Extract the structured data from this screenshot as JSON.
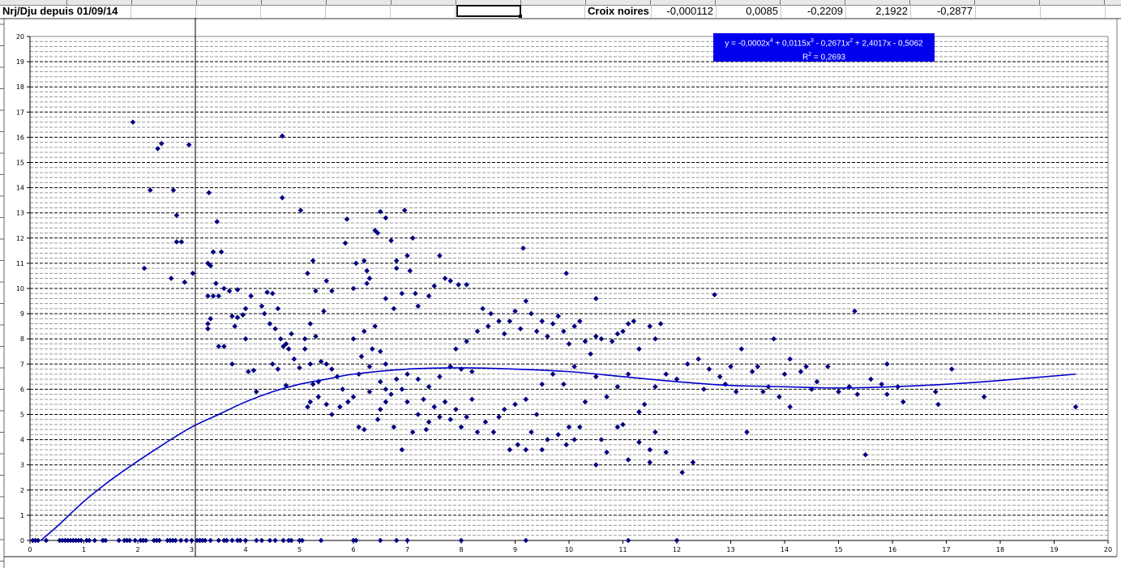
{
  "spreadsheet": {
    "title_cell": "Nrj/Dju depuis 01/09/14",
    "label_cell": "Croix noires",
    "coefficients": [
      "-0,000112",
      "0,0085",
      "-0,2209",
      "2,1922",
      "-0,2877"
    ]
  },
  "chart_data": {
    "type": "scatter",
    "title": "",
    "xlabel": "",
    "ylabel": "",
    "xlim": [
      0,
      20
    ],
    "ylim": [
      0,
      20
    ],
    "grid": "major dashed every 1, minor dashed every 0.2 (horizontal)",
    "x_ticks": [
      "0",
      "1",
      "2",
      "3",
      "4",
      "5",
      "6",
      "7",
      "8",
      "9",
      "10",
      "11",
      "12",
      "13",
      "14",
      "15",
      "16",
      "17",
      "18",
      "19",
      "20"
    ],
    "y_ticks": [
      "0",
      "1",
      "2",
      "3",
      "4",
      "5",
      "6",
      "7",
      "8",
      "9",
      "10",
      "11",
      "12",
      "13",
      "14",
      "15",
      "16",
      "17",
      "18",
      "19",
      "20"
    ],
    "marker_color": "#000080",
    "trend_color": "#0000cc",
    "trendline": {
      "type": "polynomial order 4",
      "equation_parts": [
        "y = -0,0002x",
        "4",
        " + 0,0115x",
        "3",
        " - 0,2671x",
        "2",
        " + 2,4017x - 0,5062"
      ],
      "r2_prefix": "R",
      "r2_sup": "2",
      "r2_value": " = 0,2693",
      "points": [
        [
          0.2,
          0
        ],
        [
          0.5,
          0.55
        ],
        [
          1,
          1.55
        ],
        [
          1.5,
          2.4
        ],
        [
          2,
          3.15
        ],
        [
          2.5,
          3.85
        ],
        [
          3,
          4.5
        ],
        [
          3.5,
          5.0
        ],
        [
          4,
          5.5
        ],
        [
          4.5,
          5.9
        ],
        [
          5,
          6.2
        ],
        [
          5.5,
          6.4
        ],
        [
          6,
          6.6
        ],
        [
          7,
          6.8
        ],
        [
          8,
          6.85
        ],
        [
          9,
          6.8
        ],
        [
          10,
          6.7
        ],
        [
          11,
          6.5
        ],
        [
          12,
          6.3
        ],
        [
          13,
          6.15
        ],
        [
          14,
          6.1
        ],
        [
          15,
          6.05
        ],
        [
          16,
          6.1
        ],
        [
          17,
          6.2
        ],
        [
          18,
          6.35
        ],
        [
          19.4,
          6.6
        ]
      ]
    },
    "points": [
      [
        1.91,
        16.6
      ],
      [
        2.23,
        13.9
      ],
      [
        2.37,
        15.55
      ],
      [
        2.44,
        15.75
      ],
      [
        2.66,
        13.9
      ],
      [
        2.72,
        12.9
      ],
      [
        2.72,
        11.85
      ],
      [
        2.81,
        11.85
      ],
      [
        2.95,
        15.7
      ],
      [
        2.12,
        10.8
      ],
      [
        2.62,
        10.4
      ],
      [
        2.87,
        10.25
      ],
      [
        3.02,
        10.6
      ],
      [
        3.32,
        13.8
      ],
      [
        3.47,
        12.65
      ],
      [
        4.68,
        16.05
      ],
      [
        4.68,
        13.6
      ],
      [
        5.02,
        13.1
      ],
      [
        5.88,
        12.75
      ],
      [
        3.3,
        11.0
      ],
      [
        3.35,
        10.9
      ],
      [
        3.4,
        11.45
      ],
      [
        3.55,
        11.45
      ],
      [
        3.3,
        9.7
      ],
      [
        3.4,
        9.7
      ],
      [
        3.5,
        9.7
      ],
      [
        3.45,
        10.2
      ],
      [
        3.6,
        10.0
      ],
      [
        3.7,
        9.9
      ],
      [
        3.85,
        9.95
      ],
      [
        3.3,
        8.6
      ],
      [
        3.35,
        8.8
      ],
      [
        3.3,
        8.4
      ],
      [
        3.75,
        8.9
      ],
      [
        3.85,
        8.85
      ],
      [
        3.95,
        8.95
      ],
      [
        3.8,
        8.5
      ],
      [
        4.0,
        9.2
      ],
      [
        4.1,
        9.7
      ],
      [
        3.5,
        7.7
      ],
      [
        3.6,
        7.7
      ],
      [
        4.0,
        8.0
      ],
      [
        3.75,
        7.0
      ],
      [
        4.05,
        6.7
      ],
      [
        4.15,
        6.75
      ],
      [
        4.2,
        5.9
      ],
      [
        4.3,
        9.3
      ],
      [
        4.4,
        9.85
      ],
      [
        4.5,
        9.8
      ],
      [
        4.35,
        9.0
      ],
      [
        4.45,
        8.6
      ],
      [
        4.55,
        8.4
      ],
      [
        4.6,
        9.2
      ],
      [
        4.65,
        8.0
      ],
      [
        4.7,
        7.7
      ],
      [
        4.8,
        7.6
      ],
      [
        4.9,
        7.2
      ],
      [
        4.75,
        7.8
      ],
      [
        4.85,
        8.2
      ],
      [
        4.5,
        7.0
      ],
      [
        4.6,
        6.8
      ],
      [
        4.75,
        6.15
      ],
      [
        5.0,
        6.85
      ],
      [
        5.1,
        7.6
      ],
      [
        5.2,
        7.0
      ],
      [
        5.15,
        10.6
      ],
      [
        5.25,
        11.1
      ],
      [
        5.3,
        9.9
      ],
      [
        5.5,
        10.3
      ],
      [
        5.6,
        9.9
      ],
      [
        5.45,
        9.1
      ],
      [
        5.2,
        8.6
      ],
      [
        5.1,
        8.0
      ],
      [
        5.3,
        8.1
      ],
      [
        5.4,
        7.1
      ],
      [
        5.5,
        7.0
      ],
      [
        5.6,
        6.8
      ],
      [
        5.7,
        6.5
      ],
      [
        5.35,
        6.3
      ],
      [
        5.25,
        6.2
      ],
      [
        5.2,
        5.5
      ],
      [
        5.15,
        5.3
      ],
      [
        5.35,
        5.7
      ],
      [
        5.5,
        5.4
      ],
      [
        5.6,
        5.0
      ],
      [
        5.75,
        5.3
      ],
      [
        5.8,
        6.0
      ],
      [
        5.9,
        5.5
      ],
      [
        6.0,
        5.7
      ],
      [
        5.85,
        11.8
      ],
      [
        6.05,
        11.0
      ],
      [
        6.2,
        11.1
      ],
      [
        6.0,
        10.0
      ],
      [
        6.25,
        10.7
      ],
      [
        6.3,
        10.4
      ],
      [
        6.25,
        10.2
      ],
      [
        6.4,
        12.3
      ],
      [
        6.45,
        12.2
      ],
      [
        6.5,
        13.05
      ],
      [
        6.6,
        12.8
      ],
      [
        6.7,
        11.9
      ],
      [
        6.8,
        11.1
      ],
      [
        6.8,
        10.8
      ],
      [
        6.95,
        13.1
      ],
      [
        7.0,
        11.3
      ],
      [
        7.1,
        12.0
      ],
      [
        7.05,
        10.7
      ],
      [
        6.6,
        9.6
      ],
      [
        6.75,
        9.2
      ],
      [
        6.9,
        9.8
      ],
      [
        7.15,
        9.8
      ],
      [
        7.2,
        9.3
      ],
      [
        7.4,
        9.7
      ],
      [
        7.5,
        10.1
      ],
      [
        7.6,
        11.3
      ],
      [
        7.7,
        10.4
      ],
      [
        7.8,
        10.3
      ],
      [
        7.95,
        10.15
      ],
      [
        8.1,
        10.15
      ],
      [
        6.0,
        8.0
      ],
      [
        6.2,
        8.3
      ],
      [
        6.4,
        8.5
      ],
      [
        6.15,
        7.3
      ],
      [
        6.35,
        7.6
      ],
      [
        6.5,
        7.5
      ],
      [
        6.6,
        7.0
      ],
      [
        6.1,
        6.6
      ],
      [
        6.3,
        6.9
      ],
      [
        6.5,
        6.3
      ],
      [
        6.7,
        5.8
      ],
      [
        6.9,
        6.0
      ],
      [
        7.0,
        5.5
      ],
      [
        7.2,
        5.0
      ],
      [
        7.3,
        5.6
      ],
      [
        7.4,
        4.7
      ],
      [
        7.5,
        5.3
      ],
      [
        7.6,
        4.9
      ],
      [
        7.7,
        5.5
      ],
      [
        7.8,
        4.8
      ],
      [
        7.9,
        5.2
      ],
      [
        8.0,
        4.5
      ],
      [
        8.1,
        4.9
      ],
      [
        8.2,
        5.6
      ],
      [
        8.3,
        4.3
      ],
      [
        8.45,
        4.7
      ],
      [
        8.6,
        4.3
      ],
      [
        8.7,
        4.9
      ],
      [
        8.8,
        5.2
      ],
      [
        6.6,
        5.5
      ],
      [
        6.45,
        4.8
      ],
      [
        6.75,
        4.5
      ],
      [
        6.9,
        3.6
      ],
      [
        7.1,
        4.3
      ],
      [
        7.35,
        4.4
      ],
      [
        6.2,
        4.4
      ],
      [
        6.1,
        4.5
      ],
      [
        6.3,
        5.9
      ],
      [
        6.5,
        5.2
      ],
      [
        6.6,
        6.0
      ],
      [
        6.8,
        6.4
      ],
      [
        7.0,
        6.6
      ],
      [
        7.2,
        6.4
      ],
      [
        7.4,
        6.1
      ],
      [
        7.6,
        6.5
      ],
      [
        7.8,
        6.9
      ],
      [
        8.0,
        6.8
      ],
      [
        8.2,
        6.7
      ],
      [
        7.9,
        7.6
      ],
      [
        8.1,
        7.9
      ],
      [
        8.3,
        8.3
      ],
      [
        8.4,
        9.2
      ],
      [
        8.5,
        8.5
      ],
      [
        8.55,
        9.0
      ],
      [
        8.7,
        8.7
      ],
      [
        8.8,
        8.2
      ],
      [
        8.9,
        8.7
      ],
      [
        9.0,
        9.1
      ],
      [
        9.1,
        8.4
      ],
      [
        9.2,
        9.5
      ],
      [
        9.3,
        9.0
      ],
      [
        9.4,
        8.3
      ],
      [
        9.5,
        8.7
      ],
      [
        9.6,
        8.1
      ],
      [
        9.7,
        8.6
      ],
      [
        9.8,
        8.9
      ],
      [
        9.9,
        8.3
      ],
      [
        10.0,
        7.8
      ],
      [
        10.1,
        8.5
      ],
      [
        10.2,
        8.7
      ],
      [
        10.3,
        7.9
      ],
      [
        10.4,
        7.4
      ],
      [
        10.5,
        9.6
      ],
      [
        10.5,
        8.1
      ],
      [
        10.6,
        8.0
      ],
      [
        10.8,
        7.9
      ],
      [
        10.9,
        8.2
      ],
      [
        11.0,
        8.3
      ],
      [
        11.1,
        8.6
      ],
      [
        11.2,
        8.7
      ],
      [
        11.3,
        7.6
      ],
      [
        11.5,
        8.5
      ],
      [
        11.6,
        8.0
      ],
      [
        11.7,
        8.6
      ],
      [
        9.15,
        11.6
      ],
      [
        9.95,
        10.6
      ],
      [
        8.9,
        3.6
      ],
      [
        9.05,
        3.8
      ],
      [
        9.2,
        3.6
      ],
      [
        9.3,
        4.3
      ],
      [
        9.5,
        3.6
      ],
      [
        9.6,
        4.0
      ],
      [
        9.8,
        4.2
      ],
      [
        9.95,
        3.8
      ],
      [
        10.0,
        4.5
      ],
      [
        10.1,
        4.0
      ],
      [
        10.2,
        4.5
      ],
      [
        10.5,
        3.0
      ],
      [
        10.6,
        4.0
      ],
      [
        10.7,
        3.5
      ],
      [
        10.9,
        4.5
      ],
      [
        11.0,
        4.6
      ],
      [
        11.1,
        3.2
      ],
      [
        11.3,
        3.9
      ],
      [
        11.5,
        3.6
      ],
      [
        11.5,
        3.1
      ],
      [
        11.6,
        4.3
      ],
      [
        11.8,
        3.5
      ],
      [
        12.1,
        2.7
      ],
      [
        12.3,
        3.1
      ],
      [
        9.0,
        5.4
      ],
      [
        9.2,
        5.6
      ],
      [
        9.4,
        5.0
      ],
      [
        9.5,
        6.2
      ],
      [
        9.7,
        6.6
      ],
      [
        9.9,
        6.2
      ],
      [
        10.1,
        6.9
      ],
      [
        10.3,
        5.5
      ],
      [
        10.5,
        6.5
      ],
      [
        10.7,
        5.7
      ],
      [
        10.9,
        6.1
      ],
      [
        11.1,
        6.6
      ],
      [
        11.3,
        5.1
      ],
      [
        11.4,
        5.4
      ],
      [
        11.6,
        6.1
      ],
      [
        11.8,
        6.6
      ],
      [
        12.0,
        6.4
      ],
      [
        12.2,
        7.0
      ],
      [
        12.4,
        7.2
      ],
      [
        12.6,
        6.8
      ],
      [
        12.7,
        9.75
      ],
      [
        12.8,
        6.5
      ],
      [
        13.0,
        6.9
      ],
      [
        13.2,
        7.6
      ],
      [
        13.4,
        6.7
      ],
      [
        13.5,
        6.9
      ],
      [
        13.6,
        5.9
      ],
      [
        13.8,
        8.0
      ],
      [
        13.9,
        5.7
      ],
      [
        14.0,
        6.6
      ],
      [
        14.1,
        7.2
      ],
      [
        14.3,
        6.7
      ],
      [
        14.4,
        6.9
      ],
      [
        14.6,
        6.3
      ],
      [
        14.8,
        6.9
      ],
      [
        15.0,
        5.9
      ],
      [
        15.3,
        9.1
      ],
      [
        15.35,
        5.8
      ],
      [
        15.5,
        3.4
      ],
      [
        15.6,
        6.4
      ],
      [
        15.9,
        7.0
      ],
      [
        15.9,
        5.8
      ],
      [
        16.2,
        5.5
      ],
      [
        16.8,
        5.9
      ],
      [
        16.85,
        5.4
      ],
      [
        17.1,
        6.8
      ],
      [
        17.7,
        5.7
      ],
      [
        19.4,
        5.3
      ],
      [
        13.3,
        4.3
      ],
      [
        14.1,
        5.3
      ],
      [
        12.5,
        6.0
      ],
      [
        12.9,
        6.2
      ],
      [
        13.1,
        5.9
      ],
      [
        13.7,
        6.1
      ],
      [
        14.5,
        6.0
      ],
      [
        15.2,
        6.1
      ],
      [
        15.8,
        6.2
      ],
      [
        16.1,
        6.1
      ],
      [
        0.05,
        0
      ],
      [
        0.1,
        0
      ],
      [
        0.15,
        0
      ],
      [
        0.3,
        0
      ],
      [
        0.55,
        0
      ],
      [
        0.6,
        0
      ],
      [
        0.65,
        0
      ],
      [
        0.7,
        0
      ],
      [
        0.75,
        0
      ],
      [
        0.8,
        0
      ],
      [
        0.85,
        0
      ],
      [
        0.9,
        0
      ],
      [
        0.95,
        0
      ],
      [
        1.05,
        0
      ],
      [
        1.1,
        0
      ],
      [
        1.2,
        0
      ],
      [
        1.35,
        0
      ],
      [
        1.4,
        0
      ],
      [
        1.65,
        0
      ],
      [
        1.75,
        0
      ],
      [
        1.8,
        0
      ],
      [
        1.85,
        0
      ],
      [
        1.95,
        0
      ],
      [
        2.05,
        0
      ],
      [
        2.1,
        0
      ],
      [
        2.15,
        0
      ],
      [
        2.3,
        0
      ],
      [
        2.35,
        0
      ],
      [
        2.4,
        0
      ],
      [
        2.55,
        0
      ],
      [
        2.6,
        0
      ],
      [
        2.65,
        0
      ],
      [
        2.7,
        0
      ],
      [
        2.8,
        0
      ],
      [
        2.9,
        0
      ],
      [
        3.0,
        0
      ],
      [
        3.1,
        0
      ],
      [
        3.15,
        0
      ],
      [
        3.2,
        0
      ],
      [
        3.25,
        0
      ],
      [
        3.35,
        0
      ],
      [
        3.5,
        0
      ],
      [
        3.6,
        0
      ],
      [
        3.65,
        0
      ],
      [
        3.75,
        0
      ],
      [
        3.85,
        0
      ],
      [
        3.9,
        0
      ],
      [
        4.0,
        0
      ],
      [
        4.2,
        0
      ],
      [
        4.3,
        0
      ],
      [
        4.45,
        0
      ],
      [
        4.55,
        0
      ],
      [
        4.7,
        0
      ],
      [
        4.8,
        0
      ],
      [
        4.85,
        0
      ],
      [
        5.0,
        0
      ],
      [
        5.05,
        0
      ],
      [
        5.4,
        0
      ],
      [
        6.0,
        0
      ],
      [
        6.05,
        0
      ],
      [
        6.5,
        0
      ],
      [
        6.8,
        0
      ],
      [
        7.0,
        0
      ],
      [
        8.0,
        0
      ],
      [
        9.2,
        0
      ],
      [
        11.1,
        0
      ],
      [
        12.0,
        0
      ]
    ]
  }
}
